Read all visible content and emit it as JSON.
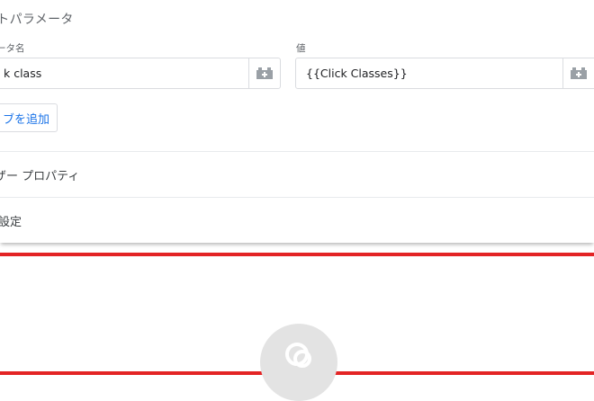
{
  "section": {
    "title": "ントパラメータ"
  },
  "param_name": {
    "label": "ータ名",
    "value": "k class",
    "variable_icon": "variable-brick-icon"
  },
  "param_value": {
    "label": "値",
    "value": "{{Click Classes}}",
    "variable_icon": "variable-brick-icon"
  },
  "add_button": {
    "label": "ブを追加"
  },
  "rows": {
    "trigger_properties": "ザー プロパティ",
    "settings": "設定"
  },
  "colors": {
    "accent": "#1a73e8",
    "highlight": "#e32425",
    "border": "#dadce0"
  },
  "loading_icon": "loading-spinner-icon"
}
